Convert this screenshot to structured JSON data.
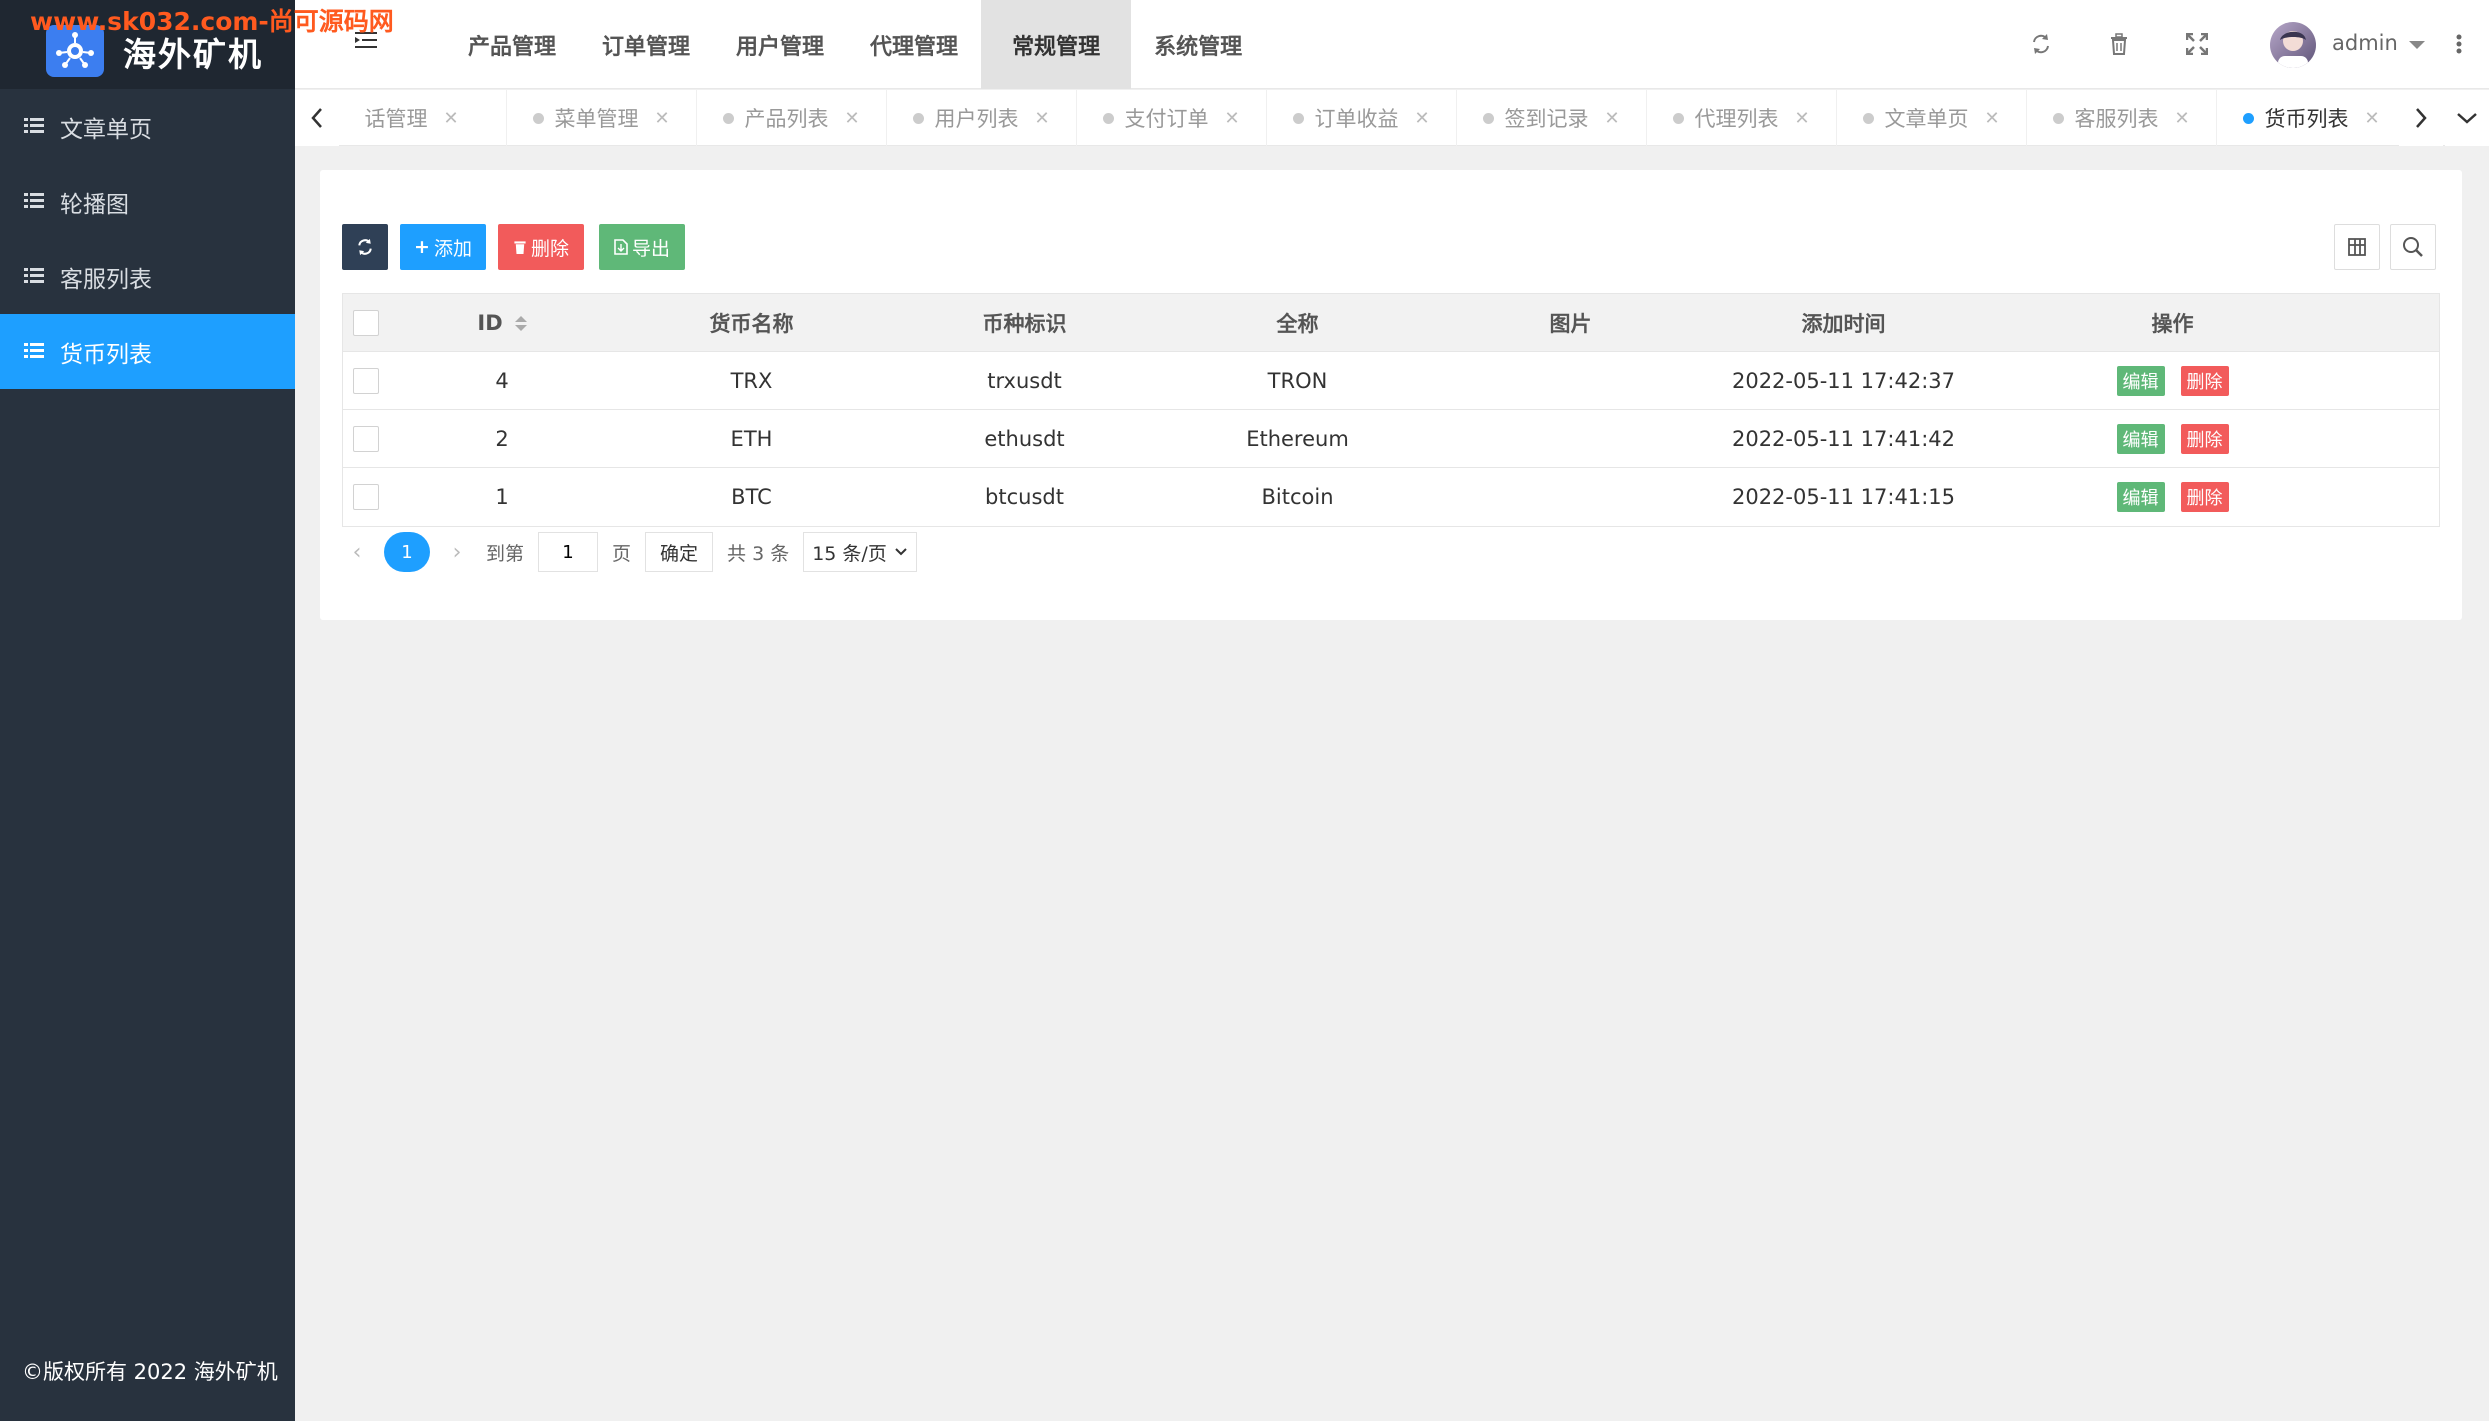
{
  "watermark": "www.sk032.com-尚可源码网",
  "app": {
    "title": "海外矿机"
  },
  "sidebar": {
    "items": [
      {
        "label": "文章单页",
        "active": false
      },
      {
        "label": "轮播图",
        "active": false
      },
      {
        "label": "客服列表",
        "active": false
      },
      {
        "label": "货币列表",
        "active": true
      }
    ],
    "copyright": "©版权所有 2022 海外矿机"
  },
  "header": {
    "nav": [
      {
        "label": "产品管理",
        "active": false
      },
      {
        "label": "订单管理",
        "active": false
      },
      {
        "label": "用户管理",
        "active": false
      },
      {
        "label": "代理管理",
        "active": false
      },
      {
        "label": "常规管理",
        "active": true
      },
      {
        "label": "系统管理",
        "active": false
      }
    ],
    "username": "admin"
  },
  "tabs": [
    {
      "label": "话管理",
      "active": false
    },
    {
      "label": "菜单管理",
      "active": false
    },
    {
      "label": "产品列表",
      "active": false
    },
    {
      "label": "用户列表",
      "active": false
    },
    {
      "label": "支付订单",
      "active": false
    },
    {
      "label": "订单收益",
      "active": false
    },
    {
      "label": "签到记录",
      "active": false
    },
    {
      "label": "代理列表",
      "active": false
    },
    {
      "label": "文章单页",
      "active": false
    },
    {
      "label": "客服列表",
      "active": false
    },
    {
      "label": "货币列表",
      "active": true
    }
  ],
  "toolbar": {
    "add": "添加",
    "delete": "删除",
    "export": "导出"
  },
  "table": {
    "columns": [
      "ID",
      "货币名称",
      "币种标识",
      "全称",
      "图片",
      "添加时间",
      "操作"
    ],
    "rows": [
      {
        "id": "4",
        "name": "TRX",
        "symbol": "trxusdt",
        "full": "TRON",
        "image": "",
        "time": "2022-05-11 17:42:37"
      },
      {
        "id": "2",
        "name": "ETH",
        "symbol": "ethusdt",
        "full": "Ethereum",
        "image": "",
        "time": "2022-05-11 17:41:42"
      },
      {
        "id": "1",
        "name": "BTC",
        "symbol": "btcusdt",
        "full": "Bitcoin",
        "image": "",
        "time": "2022-05-11 17:41:15"
      }
    ],
    "edit_label": "编辑",
    "delete_label": "删除"
  },
  "pagination": {
    "current": "1",
    "goto_prefix": "到第",
    "goto_value": "1",
    "page_suffix": "页",
    "confirm": "确定",
    "total": "共 3 条",
    "page_size": "15 条/页"
  },
  "colors": {
    "primary": "#1e9fff",
    "sidebar": "#28323e",
    "success": "#5fb878",
    "danger": "#f25b5b",
    "dark": "#2f4056"
  }
}
